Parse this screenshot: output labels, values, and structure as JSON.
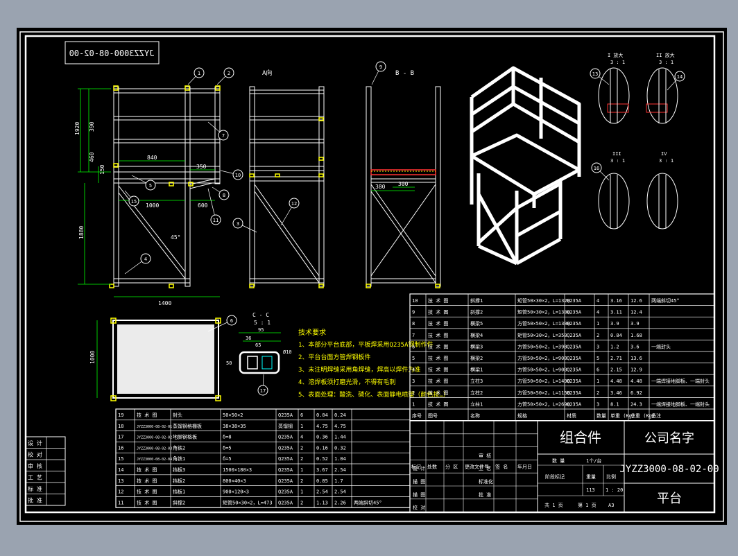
{
  "drawing": {
    "title_stamp": "JYZZ3000-08-02-00",
    "views": {
      "view_a": "A向",
      "view_b": "B - B",
      "section_c": "C - C",
      "section_c_scale": "5 : 1",
      "detail_1": "I 放大",
      "detail_1_scale": "3 : 1",
      "detail_2": "II 放大",
      "detail_2_scale": "3 : 1",
      "detail_3": "III",
      "detail_3_scale": "3 : 1",
      "detail_4": "IV",
      "detail_4_scale": "3 : 1"
    },
    "dimensions": {
      "d1920": "1920",
      "d390": "390",
      "d460": "460",
      "d150": "150",
      "d840": "840",
      "d350": "350",
      "d1000": "1000",
      "d600": "600",
      "d1880": "1880",
      "d45": "45°",
      "d1400": "1400",
      "d1000b": "1000",
      "d380": "380",
      "d300": "300",
      "d36": "36",
      "d95": "95",
      "d65": "65",
      "d50": "50",
      "d10": "Ø10",
      "d150b": "150",
      "d50b": "50"
    },
    "balloons": [
      "1",
      "2",
      "7",
      "5",
      "15",
      "10",
      "8",
      "11",
      "3",
      "4",
      "6",
      "9",
      "12",
      "13",
      "14",
      "16",
      "17"
    ],
    "tech_requirements": {
      "title": "技术要求",
      "items": [
        "1、本部分平台底部，平板焊采用Q235A钢制作件",
        "2、平台台面方管焊钢板件",
        "3、未注明焊缝采用角焊缝，焊高以焊件为准",
        "4、溶焊板须打磨光滑，不得有毛刺",
        "5、表面处理：酸洗、磷化、表面静电喷塑（颜色按…）"
      ]
    },
    "bom_upper": [
      {
        "no": "10",
        "std": "技 术 图",
        "name": "斜撑1",
        "spec": "矩管50×30×2，L=1320",
        "mat": "Q235A",
        "qty": "4",
        "unit": "3.16",
        "total": "12.6",
        "note": "两端斜切45°"
      },
      {
        "no": "9",
        "std": "技 术 图",
        "name": "斜撑2",
        "spec": "矩管50×30×2，L=1300",
        "mat": "Q235A",
        "qty": "4",
        "unit": "3.11",
        "total": "12.4",
        "note": ""
      },
      {
        "no": "8",
        "std": "技 术 图",
        "name": "横梁5",
        "spec": "方管50×50×2，L=1300",
        "mat": "Q235A",
        "qty": "1",
        "unit": "3.9",
        "total": "3.9",
        "note": ""
      },
      {
        "no": "7",
        "std": "技 术 图",
        "name": "横梁4",
        "spec": "矩管50×30×2，L=350",
        "mat": "Q235A",
        "qty": "2",
        "unit": "0.84",
        "total": "1.68",
        "note": ""
      },
      {
        "no": "6",
        "std": "技 术 图",
        "name": "横梁3",
        "spec": "方管50×50×2，L=398",
        "mat": "Q235A",
        "qty": "3",
        "unit": "1.2",
        "total": "3.6",
        "note": "一端封头"
      },
      {
        "no": "5",
        "std": "技 术 图",
        "name": "横梁2",
        "spec": "方管50×50×2，L=900",
        "mat": "Q235A",
        "qty": "5",
        "unit": "2.71",
        "total": "13.6",
        "note": ""
      },
      {
        "no": "4",
        "std": "技 术 图",
        "name": "横梁1",
        "spec": "方管50×50×2，L=900",
        "mat": "Q235A",
        "qty": "6",
        "unit": "2.15",
        "total": "12.9",
        "note": ""
      },
      {
        "no": "3",
        "std": "技 术 图",
        "name": "立柱3",
        "spec": "方管50×50×2，L=1490",
        "mat": "Q235A",
        "qty": "1",
        "unit": "4.48",
        "total": "4.48",
        "note": "一端焊接地脚板、一端封头"
      },
      {
        "no": "2",
        "std": "技 术 图",
        "name": "立柱2",
        "spec": "方管50×50×2，L=1150",
        "mat": "Q235A",
        "qty": "2",
        "unit": "3.46",
        "total": "6.92",
        "note": ""
      },
      {
        "no": "1",
        "std": "技 术 图",
        "name": "立柱1",
        "spec": "方管50×50×2，L=2690",
        "mat": "Q235A",
        "qty": "3",
        "unit": "8.1",
        "total": "24.3",
        "note": "一端焊接地脚板、一端封头"
      }
    ],
    "bom_upper_header": {
      "no": "序号",
      "std": "图号",
      "name": "名称",
      "spec": "规格",
      "mat": "材质",
      "qty": "数量",
      "unit": "单重 (Kg)",
      "total": "总重 (Kg)",
      "note": "备注"
    },
    "bom_lower": [
      {
        "no": "19",
        "std": "技 术 图",
        "name": "封头",
        "spec": "50×50×2",
        "mat": "Q235A",
        "qty": "6",
        "unit": "0.04",
        "total": "0.24",
        "note": ""
      },
      {
        "no": "18",
        "std": "JYZZ3000-08-02-01",
        "name": "蒸馏钢格栅板",
        "spec": "38×38×35",
        "mat": "蒸馏钢",
        "qty": "1",
        "unit": "4.75",
        "total": "4.75",
        "note": ""
      },
      {
        "no": "17",
        "std": "JYZZ3000-08-02-02",
        "name": "地脚钢格板",
        "spec": "δ=8",
        "mat": "Q235A",
        "qty": "4",
        "unit": "0.36",
        "total": "1.44",
        "note": ""
      },
      {
        "no": "16",
        "std": "JYZZ3000-08-02-03",
        "name": "角铁2",
        "spec": "δ=5",
        "mat": "Q235A",
        "qty": "2",
        "unit": "0.16",
        "total": "0.32",
        "note": ""
      },
      {
        "no": "15",
        "std": "JYZZ3000-08-02-04",
        "name": "角铁1",
        "spec": "δ=5",
        "mat": "Q235A",
        "qty": "2",
        "unit": "0.52",
        "total": "1.04",
        "note": ""
      },
      {
        "no": "14",
        "std": "技 术 图",
        "name": "挡板3",
        "spec": "1500×180×3",
        "mat": "Q235A",
        "qty": "1",
        "unit": "3.67",
        "total": "2.54",
        "note": ""
      },
      {
        "no": "13",
        "std": "技 术 图",
        "name": "挡板2",
        "spec": "800×40×3",
        "mat": "Q235A",
        "qty": "2",
        "unit": "0.85",
        "total": "1.7",
        "note": ""
      },
      {
        "no": "12",
        "std": "技 术 图",
        "name": "挡板1",
        "spec": "900×120×3",
        "mat": "Q235A",
        "qty": "1",
        "unit": "2.54",
        "total": "2.54",
        "note": ""
      },
      {
        "no": "11",
        "std": "技 术 图",
        "name": "斜撑2",
        "spec": "矩管50×30×2，L=473",
        "mat": "Q235A",
        "qty": "2",
        "unit": "1.13",
        "total": "2.26",
        "note": "两端斜切45°"
      }
    ],
    "sign_block": [
      "设 计",
      "校 对",
      "审 核",
      "工 艺",
      "标 准",
      "批 准"
    ],
    "title_block": {
      "assembly": "组合件",
      "company": "公司名字",
      "drawing_no": "JYZZ3000-08-02-00",
      "part_name": "平台",
      "labels_row1": [
        "标记",
        "处数",
        "分 区",
        "更改文件号",
        "签 名",
        "年月日"
      ],
      "labels_left": [
        "设 计",
        "描 图",
        "描 图",
        "校 对"
      ],
      "labels_mid": [
        "审 核",
        "工 艺",
        "标准化",
        "批 准"
      ],
      "weight_label": "数 量",
      "weight_value": "1个/台",
      "stage_label": "阶段标记",
      "weight_col": "重量",
      "scale_col": "比例",
      "weight_num": "113",
      "scale_num": "1 : 20",
      "sheets": "共 1 页",
      "sheet_no": "第 1 页",
      "size": "A3"
    }
  }
}
